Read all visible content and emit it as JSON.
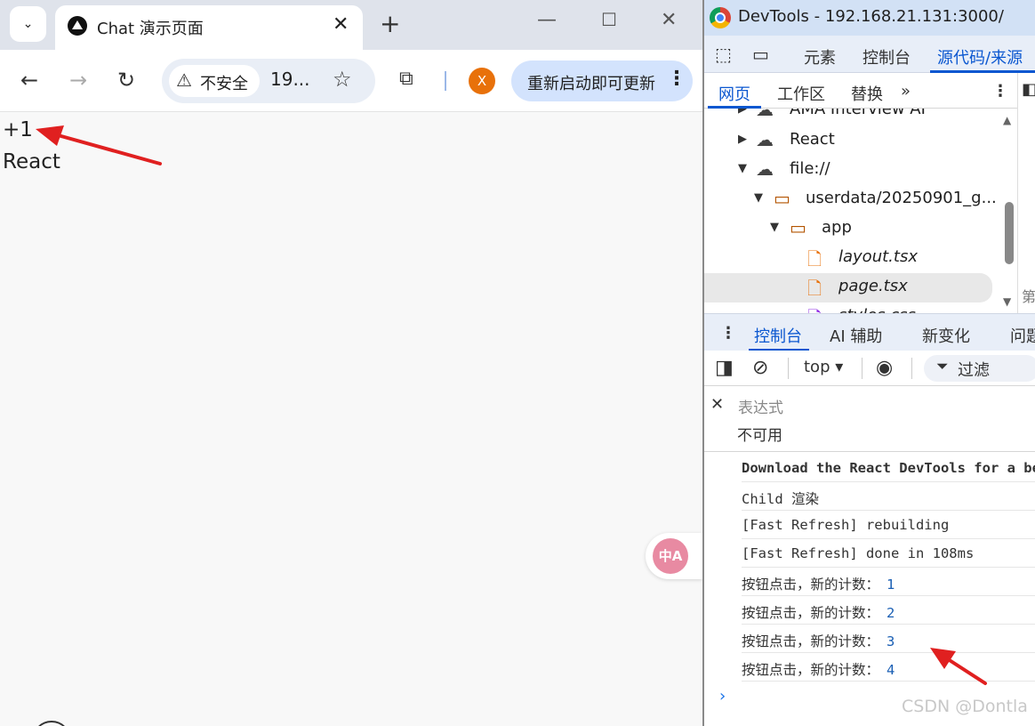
{
  "browser": {
    "tab_title": "Chat 演示页面",
    "tab_close": "✕",
    "new_tab": "+",
    "security_label": "不安全",
    "url": "19...",
    "profile_initial": "X",
    "update_button": "重新启动即可更新"
  },
  "page": {
    "plus_label": "+1",
    "react_label": "React",
    "translate_label": "中A"
  },
  "devtools": {
    "title": "DevTools - 192.168.21.131:3000/",
    "main_tabs": [
      "元素",
      "控制台",
      "源代码/来源"
    ],
    "sub_tabs": [
      "网页",
      "工作区",
      "替换"
    ],
    "tree": [
      {
        "label": "AMA Interview AI",
        "type": "cloud"
      },
      {
        "label": "React",
        "type": "cloud"
      },
      {
        "label": "file://",
        "type": "cloud"
      },
      {
        "label": "userdata/20250901_g...",
        "type": "folder"
      },
      {
        "label": "app",
        "type": "folder"
      },
      {
        "label": "layout.tsx",
        "type": "file"
      },
      {
        "label": "page.tsx",
        "type": "file"
      },
      {
        "label": "styles.css",
        "type": "file"
      }
    ],
    "side_char": "第",
    "drawer_tabs": [
      "控制台",
      "AI 辅助",
      "新变化",
      "问题"
    ],
    "context": "top ▾",
    "filter": "过滤",
    "expression_placeholder": "表达式",
    "expression_value": "不可用",
    "logs": [
      "Download the React DevTools for a better development experience",
      "Child 渲染",
      "[Fast Refresh] rebuilding",
      "[Fast Refresh] done in 108ms"
    ],
    "count_log_text": "按钮点击，新的计数：",
    "counts": [
      "1",
      "2",
      "3",
      "4"
    ],
    "prompt": "›",
    "watermark": "CSDN @Dontla"
  },
  "colors": {
    "accent": "#0b57d0",
    "annotation_arrow": "#e02020",
    "tabbar": "#dfe3eb",
    "update_button": "#d3e3fd"
  }
}
